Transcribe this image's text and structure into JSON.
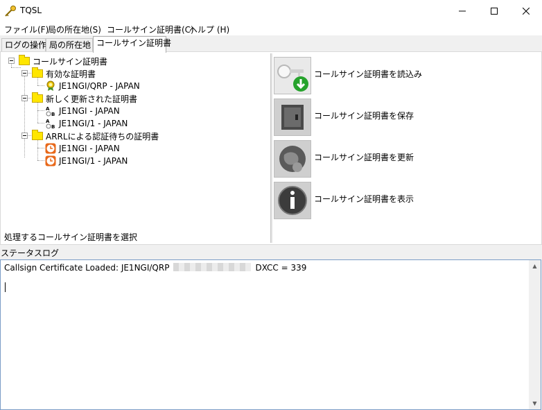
{
  "window": {
    "title": "TQSL"
  },
  "menu": [
    "ファイル(F)",
    "局の所在地(S)",
    "コールサイン証明書(C)",
    "ヘルプ (H)"
  ],
  "tabs": [
    "ログの操作",
    "局の所在地",
    "コールサイン証明書"
  ],
  "tree": {
    "root": "コールサイン証明書",
    "groups": [
      {
        "label": "有効な証明書",
        "items": [
          "JE1NGI/QRP - JAPAN"
        ]
      },
      {
        "label": "新しく更新された証明書",
        "items": [
          "JE1NGI - JAPAN",
          "JE1NGI/1 - JAPAN"
        ]
      },
      {
        "label": "ARRLによる認証待ちの証明書",
        "items": [
          "JE1NGI - JAPAN",
          "JE1NGI/1 - JAPAN"
        ]
      }
    ]
  },
  "prompt": "処理するコールサイン証明書を選択",
  "actions": [
    "コールサイン証明書を読込み",
    "コールサイン証明書を保存",
    "コールサイン証明書を更新",
    "コールサイン証明書を表示"
  ],
  "status_label": "ステータスログ",
  "log": {
    "prefix": "Callsign Certificate Loaded:  JE1NGI/QRP",
    "suffix": "DXCC = 339"
  }
}
